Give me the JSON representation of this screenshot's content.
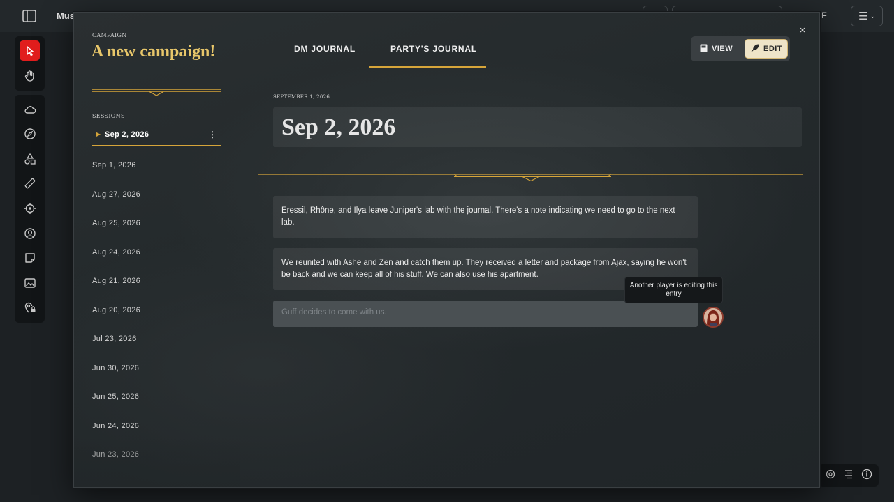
{
  "app": {
    "title": "Mush",
    "user_label": "ELF"
  },
  "colors": {
    "accent_gold": "#d6a53a",
    "title_gold": "#e7c66a",
    "active_tool_red": "#e11d1d"
  },
  "toolbar": {
    "tools": [
      "pointer-icon",
      "hand-icon",
      "cloud-icon",
      "compass-icon",
      "shapes-icon",
      "ruler-icon",
      "target-icon",
      "user-circle-icon",
      "note-icon",
      "image-icon",
      "map-pin-lock-icon"
    ]
  },
  "journal": {
    "campaign_label": "CAMPAIGN",
    "campaign_title": "A new campaign!",
    "sessions_label": "SESSIONS",
    "active_session": "Sep 2, 2026",
    "sessions": [
      "Sep 1, 2026",
      "Aug 27, 2026",
      "Aug 25, 2026",
      "Aug 24, 2026",
      "Aug 21, 2026",
      "Aug 20, 2026",
      "Jul 23, 2026",
      "Jun 30, 2026",
      "Jun 25, 2026",
      "Jun 24, 2026",
      "Jun 23, 2026"
    ],
    "tabs": [
      "DM JOURNAL",
      "PARTY'S JOURNAL"
    ],
    "active_tab": "PARTY'S JOURNAL",
    "view_label": "VIEW",
    "edit_label": "EDIT",
    "date_caption": "SEPTEMBER 1, 2026",
    "entry_title": "Sep 2, 2026",
    "entries": [
      "Eressil, Rhône, and Ilya leave Juniper's lab with the journal. There's a note indicating we need to go to the next lab.",
      "We reunited with Ashe and Zen and catch them up. They received a letter and package from Ajax, saying he won't be back and we can keep all of his stuff. We can also use his apartment."
    ],
    "locked_entry": "Guff decides to come with us.",
    "tooltip": "Another player is editing this entry",
    "close_icon": "×"
  }
}
